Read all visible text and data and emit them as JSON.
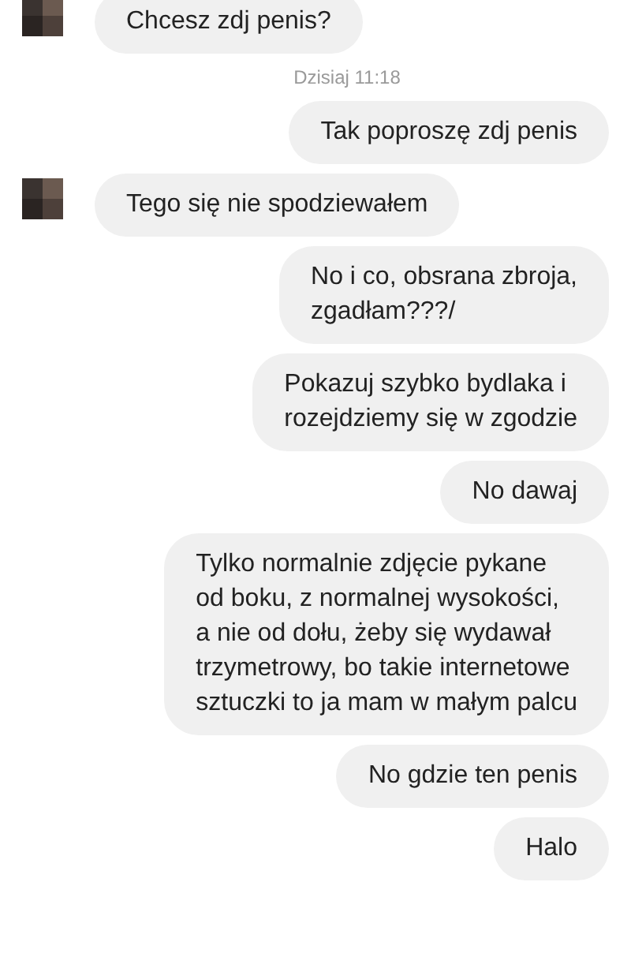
{
  "messages": [
    {
      "kind": "incoming",
      "lines": [
        "Chcesz zdj penis?"
      ]
    },
    {
      "kind": "timestamp",
      "lines": [
        "Dzisiaj 11:18"
      ]
    },
    {
      "kind": "outgoing",
      "lines": [
        "Tak poproszę zdj penis"
      ]
    },
    {
      "kind": "incoming",
      "lines": [
        "Tego się nie spodziewałem"
      ]
    },
    {
      "kind": "outgoing",
      "lines": [
        "No i co, obsrana zbroja,",
        "zgadłam???/"
      ]
    },
    {
      "kind": "outgoing",
      "lines": [
        "Pokazuj szybko bydlaka i",
        "rozejdziemy się w zgodzie"
      ]
    },
    {
      "kind": "outgoing",
      "lines": [
        "No dawaj"
      ]
    },
    {
      "kind": "outgoing",
      "lines": [
        "Tylko normalnie zdjęcie pykane",
        "od boku, z normalnej wysokości,",
        "a nie od dołu, żeby się wydawał",
        "trzymetrowy, bo takie internetowe",
        "sztuczki to ja mam w małym palcu"
      ]
    },
    {
      "kind": "outgoing",
      "lines": [
        "No gdzie ten penis"
      ]
    },
    {
      "kind": "outgoing",
      "lines": [
        "Halo"
      ]
    }
  ]
}
